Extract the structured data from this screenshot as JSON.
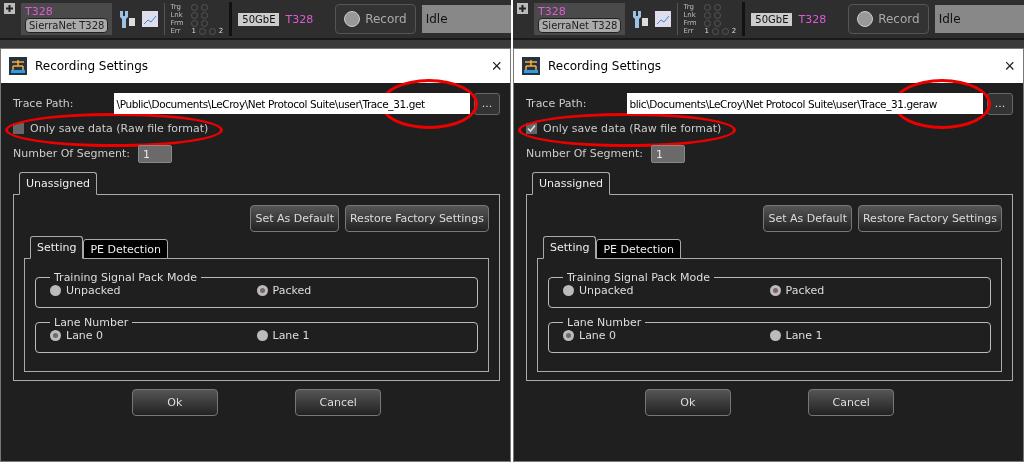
{
  "panels": [
    {
      "toolbar": {
        "device_label": "T328",
        "device_button": "SierraNet T328",
        "leds": [
          {
            "label": "Trg"
          },
          {
            "label": "Lnk"
          },
          {
            "label": "Frm"
          },
          {
            "label": "Err",
            "marks": [
              "1",
              "2"
            ]
          }
        ],
        "speed": "50GbE",
        "port": "T328",
        "record_button": "Record",
        "status": "Idle"
      },
      "dialog": {
        "title": "Recording Settings",
        "close_button": "×",
        "trace_path": {
          "label": "Trace Path:",
          "value": "\\Public\\Documents\\LeCroy\\Net Protocol Suite\\user\\Trace_31.get",
          "annotated": true
        },
        "browse_button": "...",
        "raw_format": {
          "label": "Only save data (Raw file format)",
          "checked": false,
          "annotated": true
        },
        "segments": {
          "label": "Number Of Segment:",
          "value": "1",
          "disabled": true
        },
        "outer_tabs": [
          {
            "label": "Unassigned",
            "selected": true
          }
        ],
        "action_buttons": [
          "Set As Default",
          "Restore Factory Settings"
        ],
        "inner_tabs": [
          {
            "label": "Setting",
            "selected": true
          },
          {
            "label": "PE Detection",
            "selected": false
          }
        ],
        "groups": [
          {
            "title": "Training Signal Pack Mode",
            "options": [
              {
                "label": "Unpacked",
                "selected": false
              },
              {
                "label": "Packed",
                "selected": true
              }
            ]
          },
          {
            "title": "Lane Number",
            "options": [
              {
                "label": "Lane 0",
                "selected": true
              },
              {
                "label": "Lane 1",
                "selected": false
              }
            ]
          }
        ],
        "footer_buttons": [
          "Ok",
          "Cancel"
        ]
      }
    },
    {
      "toolbar": {
        "device_label": "T328",
        "device_button": "SierraNet T328",
        "leds": [
          {
            "label": "Trg"
          },
          {
            "label": "Lnk"
          },
          {
            "label": "Frm"
          },
          {
            "label": "Err",
            "marks": [
              "1",
              "2"
            ]
          }
        ],
        "speed": "50GbE",
        "port": "T328",
        "record_button": "Record",
        "status": "Idle"
      },
      "dialog": {
        "title": "Recording Settings",
        "close_button": "×",
        "trace_path": {
          "label": "Trace Path:",
          "value": "blic\\Documents\\LeCroy\\Net Protocol Suite\\user\\Trace_31.geraw",
          "annotated": true
        },
        "browse_button": "...",
        "raw_format": {
          "label": "Only save data (Raw file format)",
          "checked": true,
          "annotated": true
        },
        "segments": {
          "label": "Number Of Segment:",
          "value": "1",
          "disabled": true
        },
        "outer_tabs": [
          {
            "label": "Unassigned",
            "selected": true
          }
        ],
        "action_buttons": [
          "Set As Default",
          "Restore Factory Settings"
        ],
        "inner_tabs": [
          {
            "label": "Setting",
            "selected": true
          },
          {
            "label": "PE Detection",
            "selected": false
          }
        ],
        "groups": [
          {
            "title": "Training Signal Pack Mode",
            "options": [
              {
                "label": "Unpacked",
                "selected": false
              },
              {
                "label": "Packed",
                "selected": true
              }
            ]
          },
          {
            "title": "Lane Number",
            "options": [
              {
                "label": "Lane 0",
                "selected": true
              },
              {
                "label": "Lane 1",
                "selected": false
              }
            ]
          }
        ],
        "footer_buttons": [
          "Ok",
          "Cancel"
        ]
      }
    }
  ]
}
